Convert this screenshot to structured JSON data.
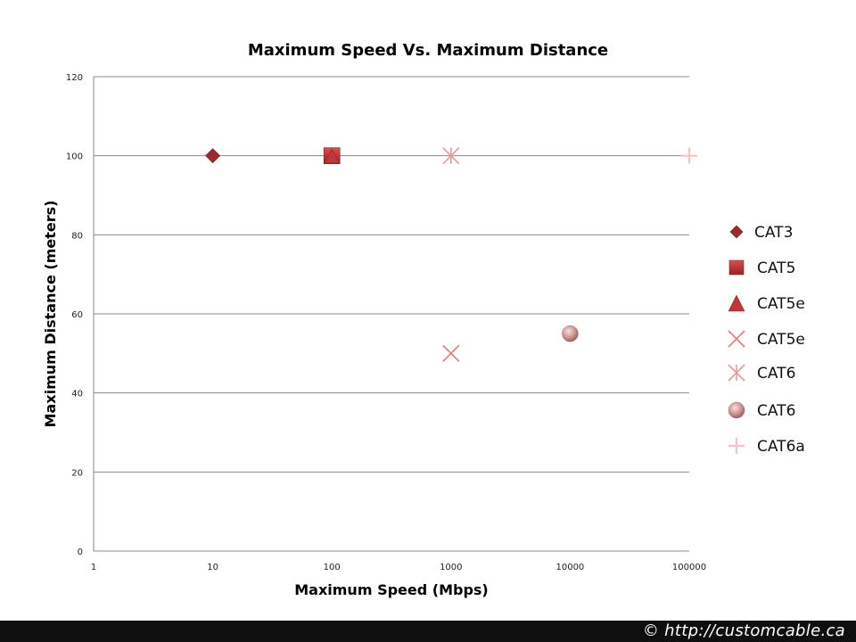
{
  "chart_data": {
    "type": "scatter",
    "title": "Maximum Speed Vs. Maximum Distance",
    "xlabel": "Maximum Speed (Mbps)",
    "ylabel": "Maximum Distance (meters)",
    "xscale": "log",
    "xlim": [
      1,
      100000
    ],
    "ylim": [
      0,
      120
    ],
    "xticks": [
      "1",
      "10",
      "100",
      "1000",
      "10000",
      "100000"
    ],
    "xtick_values": [
      1,
      10,
      100,
      1000,
      10000,
      100000
    ],
    "yticks": [
      "0",
      "20",
      "40",
      "60",
      "80",
      "100",
      "120"
    ],
    "ytick_values": [
      0,
      20,
      40,
      60,
      80,
      100,
      120
    ],
    "grid": "horizontal",
    "legend_position": "right",
    "series": [
      {
        "name": "CAT3",
        "marker": "diamond",
        "color": "#9b2a2a",
        "points": [
          {
            "x": 10,
            "y": 100
          }
        ]
      },
      {
        "name": "CAT5",
        "marker": "square",
        "color": "#b83232",
        "points": [
          {
            "x": 100,
            "y": 100
          }
        ]
      },
      {
        "name": "CAT5e",
        "marker": "triangle",
        "color": "#c13636",
        "points": [
          {
            "x": 100,
            "y": 100
          }
        ]
      },
      {
        "name": "CAT5e",
        "marker": "x",
        "color": "#e07a7a",
        "points": [
          {
            "x": 1000,
            "y": 50
          }
        ]
      },
      {
        "name": "CAT6",
        "marker": "asterisk",
        "color": "#e89a9a",
        "points": [
          {
            "x": 1000,
            "y": 100
          }
        ]
      },
      {
        "name": "CAT6",
        "marker": "circle",
        "color": "#d49a9a",
        "points": [
          {
            "x": 10000,
            "y": 55
          }
        ]
      },
      {
        "name": "CAT6a",
        "marker": "plus",
        "color": "#f2c4c4",
        "points": [
          {
            "x": 100000,
            "y": 100
          }
        ]
      }
    ]
  },
  "footer": {
    "copyright": "© http://customcable.ca"
  }
}
